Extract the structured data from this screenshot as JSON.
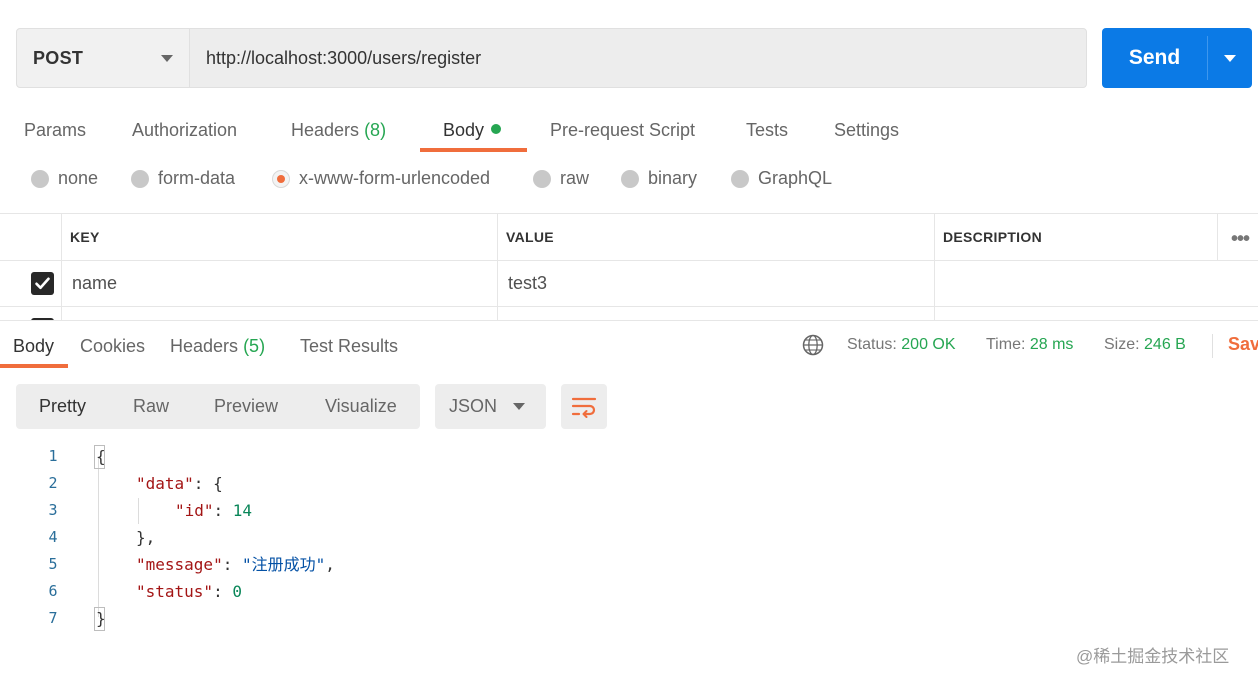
{
  "request": {
    "method": "POST",
    "url": "http://localhost:3000/users/register",
    "send_label": "Send"
  },
  "request_tabs": [
    {
      "label": "Params"
    },
    {
      "label": "Authorization"
    },
    {
      "label": "Headers",
      "count": "(8)"
    },
    {
      "label": "Body"
    },
    {
      "label": "Pre-request Script"
    },
    {
      "label": "Tests"
    },
    {
      "label": "Settings"
    }
  ],
  "body_types": [
    {
      "label": "none"
    },
    {
      "label": "form-data"
    },
    {
      "label": "x-www-form-urlencoded"
    },
    {
      "label": "raw"
    },
    {
      "label": "binary"
    },
    {
      "label": "GraphQL"
    }
  ],
  "body_type_selected": "x-www-form-urlencoded",
  "params_table": {
    "headers": {
      "key": "KEY",
      "value": "VALUE",
      "description": "DESCRIPTION"
    },
    "rows": [
      {
        "checked": true,
        "key": "name",
        "value": "test3",
        "description": ""
      }
    ]
  },
  "response": {
    "tabs": [
      {
        "label": "Body"
      },
      {
        "label": "Cookies"
      },
      {
        "label": "Headers",
        "count": "(5)"
      },
      {
        "label": "Test Results"
      }
    ],
    "status_label": "Status:",
    "status_value": "200 OK",
    "time_label": "Time:",
    "time_value": "28 ms",
    "size_label": "Size:",
    "size_value": "246 B",
    "save_label": "Sav",
    "views": [
      {
        "label": "Pretty"
      },
      {
        "label": "Raw"
      },
      {
        "label": "Preview"
      },
      {
        "label": "Visualize"
      }
    ],
    "format": "JSON",
    "code_lines": [
      {
        "num": "1",
        "text": "{"
      },
      {
        "num": "2",
        "key": "\"data\"",
        "rest": ": {"
      },
      {
        "num": "3",
        "key": "\"id\"",
        "sep": ": ",
        "number": "14"
      },
      {
        "num": "4",
        "text": "},"
      },
      {
        "num": "5",
        "key": "\"message\"",
        "sep": ": ",
        "string": "\"注册成功\"",
        "tail": ","
      },
      {
        "num": "6",
        "key": "\"status\"",
        "sep": ": ",
        "number": "0"
      },
      {
        "num": "7",
        "text": "}"
      }
    ]
  },
  "colors": {
    "accent": "#f06d3c",
    "send_blue": "#0b7ae6",
    "success_green": "#26a652"
  },
  "watermark": "@稀土掘金技术社区"
}
